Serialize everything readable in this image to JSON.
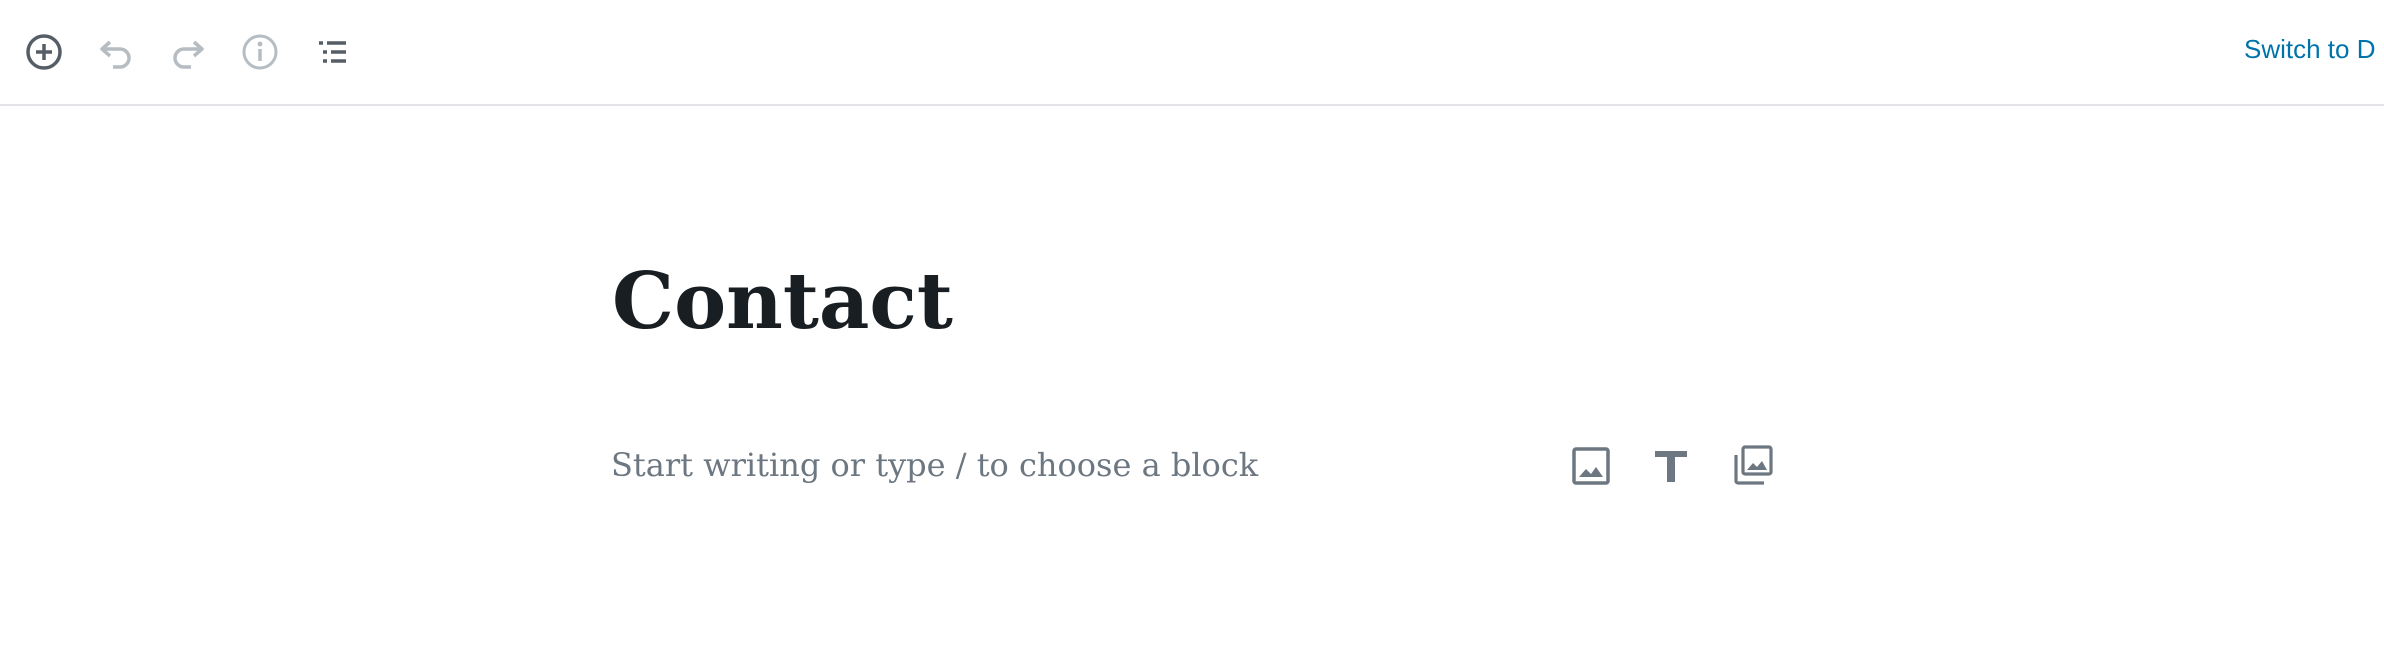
{
  "toolbar": {
    "icons": [
      "add-block-icon",
      "undo-icon",
      "redo-icon",
      "info-icon",
      "block-navigation-icon"
    ],
    "switch_label": "Switch to D"
  },
  "post": {
    "title": "Contact",
    "placeholder": "Start writing or type / to choose a block"
  },
  "quick_inserter": {
    "icons": [
      "image-icon",
      "heading-icon",
      "gallery-icon"
    ]
  },
  "colors": {
    "accent": "#0073aa",
    "icon_active": "#555d66",
    "icon_disabled": "#b5bcc2",
    "title": "#191e23",
    "placeholder": "#6c7781",
    "divider": "#e2e4e7"
  }
}
